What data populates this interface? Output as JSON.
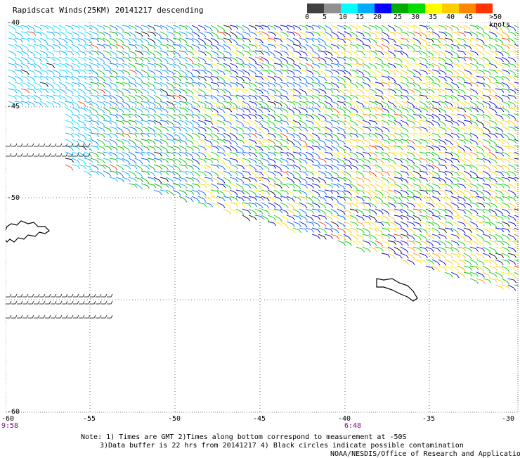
{
  "header": {
    "title": "Rapidscat Winds(25KM) 20141217 descending"
  },
  "colorbar": {
    "colors": [
      "#404040",
      "#909090",
      "#00ffff",
      "#00aaff",
      "#0000ff",
      "#00aa00",
      "#00dd00",
      "#ffff00",
      "#ffcc00",
      "#ff8800",
      "#ff3300",
      "#cc0000",
      "#8b4513",
      "#c08060",
      "#ff00ff",
      "#aa00ff",
      "#660099"
    ],
    "labels": [
      "0",
      "5",
      "10",
      "15",
      "20",
      "25",
      "30",
      "35",
      "40",
      "45",
      ">50 knots"
    ]
  },
  "map": {
    "lon_ticks": [
      "-60",
      "-55",
      "-50",
      "-45",
      "-40",
      "-35",
      "-30"
    ],
    "lat_ticks": [
      "-40",
      "-45",
      "-50",
      "-60"
    ],
    "times": [
      "9:58",
      "6:48"
    ]
  },
  "notes": {
    "line1": "Note: 1) Times are GMT 2)Times along bottom correspond to measurement at -50S",
    "line2": "3)Data buffer is 22 hrs from 20141217 4) Black circles indicate possible contamination",
    "line3": "NOAA/NESDIS/Office of Research and Applications"
  }
}
